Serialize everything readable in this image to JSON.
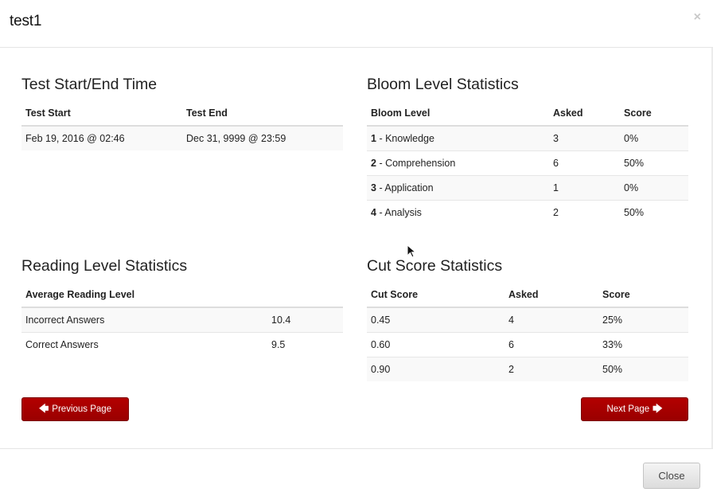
{
  "modal": {
    "title": "test1",
    "close_glyph": "×"
  },
  "test_time": {
    "heading": "Test Start/End Time",
    "columns": [
      "Test Start",
      "Test End"
    ],
    "rows": [
      {
        "start": "Feb 19, 2016 @ 02:46",
        "end": "Dec 31, 9999 @ 23:59"
      }
    ]
  },
  "bloom": {
    "heading": "Bloom Level Statistics",
    "columns": [
      "Bloom Level",
      "Asked",
      "Score"
    ],
    "rows": [
      {
        "num": "1",
        "name": "- Knowledge",
        "asked": "3",
        "score": "0%"
      },
      {
        "num": "2",
        "name": "- Comprehension",
        "asked": "6",
        "score": "50%"
      },
      {
        "num": "3",
        "name": "- Application",
        "asked": "1",
        "score": "0%"
      },
      {
        "num": "4",
        "name": "- Analysis",
        "asked": "2",
        "score": "50%"
      }
    ]
  },
  "reading": {
    "heading": "Reading Level Statistics",
    "columns": [
      "Average Reading Level",
      ""
    ],
    "rows": [
      {
        "label": "Incorrect Answers",
        "value": "10.4"
      },
      {
        "label": "Correct Answers",
        "value": "9.5"
      }
    ]
  },
  "cut_score": {
    "heading": "Cut Score Statistics",
    "columns": [
      "Cut Score",
      "Asked",
      "Score"
    ],
    "rows": [
      {
        "cut": "0.45",
        "asked": "4",
        "score": "25%"
      },
      {
        "cut": "0.60",
        "asked": "6",
        "score": "33%"
      },
      {
        "cut": "0.90",
        "asked": "2",
        "score": "50%"
      }
    ]
  },
  "nav": {
    "prev_label": "Previous Page",
    "next_label": "Next Page",
    "prev_icon": "arrow-left-icon",
    "next_icon": "arrow-right-icon"
  },
  "footer": {
    "close_label": "Close"
  },
  "colors": {
    "primary_red": "#a80000",
    "border": "#dddddd",
    "stripe": "#f9f9f9"
  }
}
